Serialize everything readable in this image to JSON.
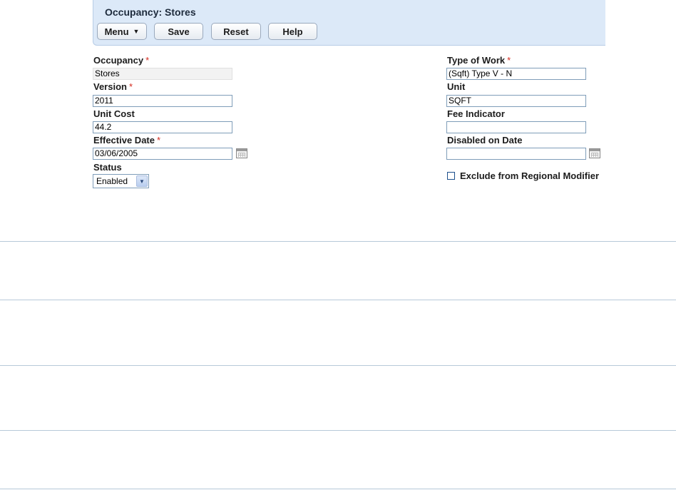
{
  "header": {
    "title": "Occupancy: Stores",
    "buttons": {
      "menu": "Menu",
      "save": "Save",
      "reset": "Reset",
      "help": "Help"
    }
  },
  "form": {
    "required_marker": "*",
    "occupancy": {
      "label": "Occupancy",
      "value": "Stores"
    },
    "version": {
      "label": "Version",
      "value": "2011"
    },
    "unit_cost": {
      "label": "Unit Cost",
      "value": "44.2"
    },
    "effective_date": {
      "label": "Effective Date",
      "value": "03/06/2005"
    },
    "status": {
      "label": "Status",
      "value": "Enabled"
    },
    "type_of_work": {
      "label": "Type of Work",
      "value": "(Sqft) Type V - N"
    },
    "unit": {
      "label": "Unit",
      "value": "SQFT"
    },
    "fee_indicator": {
      "label": "Fee Indicator",
      "value": ""
    },
    "disabled_on_date": {
      "label": "Disabled on Date",
      "value": ""
    },
    "exclude_regional_modifier": {
      "label": "Exclude from Regional Modifier",
      "checked": false
    }
  }
}
